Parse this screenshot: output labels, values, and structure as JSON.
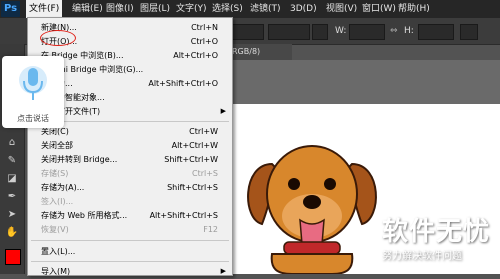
{
  "app": {
    "logo": "Ps"
  },
  "menubar": {
    "items": [
      {
        "label": "文件(F)"
      },
      {
        "label": "编辑(E)"
      },
      {
        "label": "图像(I)"
      },
      {
        "label": "图层(L)"
      },
      {
        "label": "文字(Y)"
      },
      {
        "label": "选择(S)"
      },
      {
        "label": "滤镜(T)"
      },
      {
        "label": "3D(D)"
      },
      {
        "label": "视图(V)"
      },
      {
        "label": "窗口(W)"
      },
      {
        "label": "帮助(H)"
      }
    ]
  },
  "options_bar": {
    "width_label": "W:",
    "height_label": "H:"
  },
  "document": {
    "tab_label": "RGB/8)"
  },
  "file_menu": {
    "items": [
      {
        "label": "新建(N)...",
        "shortcut": "Ctrl+N"
      },
      {
        "label": "打开(O)...",
        "shortcut": "Ctrl+O"
      },
      {
        "label": "在 Bridge 中浏览(B)...",
        "shortcut": "Alt+Ctrl+O"
      },
      {
        "label": "在 Mini Bridge 中浏览(G)...",
        "shortcut": ""
      },
      {
        "label": "打开为...",
        "shortcut": "Alt+Shift+Ctrl+O"
      },
      {
        "label": "打开为智能对象...",
        "shortcut": ""
      },
      {
        "label": "最近打开文件(T)",
        "shortcut": ""
      },
      {
        "label": "关闭(C)",
        "shortcut": "Ctrl+W"
      },
      {
        "label": "关闭全部",
        "shortcut": "Alt+Ctrl+W"
      },
      {
        "label": "关闭并转到 Bridge...",
        "shortcut": "Shift+Ctrl+W"
      },
      {
        "label": "存储(S)",
        "shortcut": "Ctrl+S"
      },
      {
        "label": "存储为(A)...",
        "shortcut": "Shift+Ctrl+S"
      },
      {
        "label": "签入(I)...",
        "shortcut": ""
      },
      {
        "label": "存储为 Web 所用格式...",
        "shortcut": "Alt+Shift+Ctrl+S"
      },
      {
        "label": "恢复(V)",
        "shortcut": "F12"
      },
      {
        "label": "置入(L)...",
        "shortcut": ""
      },
      {
        "label": "导入(M)",
        "shortcut": ""
      }
    ]
  },
  "voice_widget": {
    "label": "点击说话"
  },
  "watermark": {
    "title": "软件无忧",
    "subtitle": "努力解决软件问题"
  },
  "colors": {
    "foreground": "#ff0000",
    "highlight_circle": "#e0231a"
  }
}
